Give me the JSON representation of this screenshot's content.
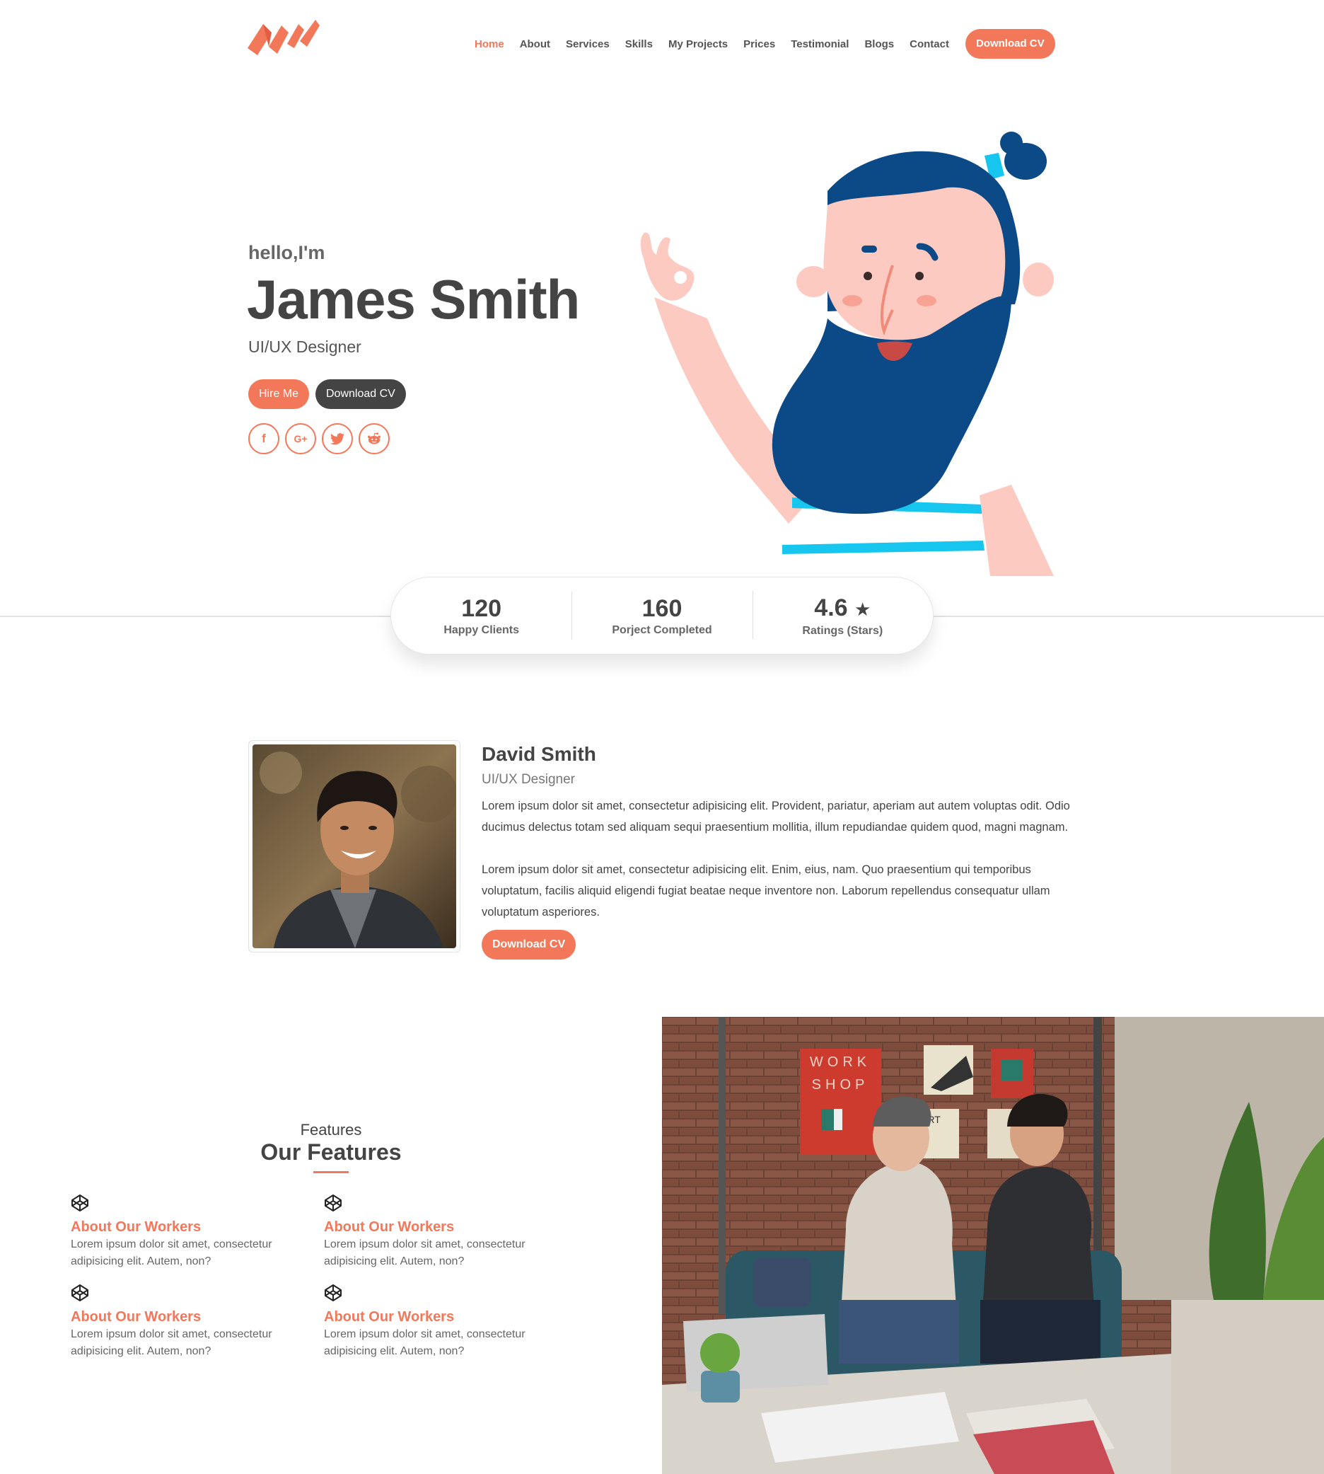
{
  "nav": {
    "items": [
      {
        "label": "Home",
        "active": true
      },
      {
        "label": "About"
      },
      {
        "label": "Services"
      },
      {
        "label": "Skills"
      },
      {
        "label": "My Projects"
      },
      {
        "label": "Prices"
      },
      {
        "label": "Testimonial"
      },
      {
        "label": "Blogs"
      },
      {
        "label": "Contact"
      }
    ],
    "cta": "Download CV"
  },
  "hero": {
    "greeting": "hello,I'm",
    "name": "James Smith",
    "role": "UI/UX Designer",
    "hire_label": "Hire Me",
    "cv_label": "Download CV",
    "socials": [
      {
        "icon": "facebook-icon",
        "glyph": "f"
      },
      {
        "icon": "google-plus-icon",
        "glyph": "G+"
      },
      {
        "icon": "twitter-icon",
        "glyph": "t"
      },
      {
        "icon": "reddit-icon",
        "glyph": "r"
      }
    ]
  },
  "stats": [
    {
      "value": "120",
      "label": "Happy Clients"
    },
    {
      "value": "160",
      "label": "Porject Completed"
    },
    {
      "value": "4.6",
      "label": "Ratings (Stars)",
      "icon": "star-icon"
    }
  ],
  "about": {
    "name": "David Smith",
    "role": "UI/UX Designer",
    "p1": "Lorem ipsum dolor sit amet, consectetur adipisicing elit. Provident, pariatur, aperiam aut autem voluptas odit. Odio ducimus delectus totam sed aliquam sequi praesentium mollitia, illum repudiandae quidem quod, magni magnam.",
    "p2": "Lorem ipsum dolor sit amet, consectetur adipisicing elit. Enim, eius, nam. Quo praesentium qui temporibus voluptatum, facilis aliquid eligendi fugiat beatae neque inventore non. Laborum repellendus consequatur ullam voluptatum asperiores.",
    "cv_label": "Download CV"
  },
  "features": {
    "eyebrow": "Features",
    "title": "Our Features",
    "items": [
      {
        "title": "About Our Workers",
        "text": "Lorem ipsum dolor sit amet, consectetur adipisicing elit. Autem, non?"
      },
      {
        "title": "About Our Workers",
        "text": "Lorem ipsum dolor sit amet, consectetur adipisicing elit. Autem, non?"
      },
      {
        "title": "About Our Workers",
        "text": "Lorem ipsum dolor sit amet, consectetur adipisicing elit. Autem, non?"
      },
      {
        "title": "About Our Workers",
        "text": "Lorem ipsum dolor sit amet, consectetur adipisicing elit. Autem, non?"
      }
    ]
  },
  "workshop_poster": {
    "line1": "WORK",
    "line2": "SHOP",
    "art": "ART"
  },
  "colors": {
    "accent": "#f3785a",
    "dark": "#444444",
    "beard": "#0b4a86",
    "cyan": "#16c6ee",
    "skin": "#fccac0"
  }
}
